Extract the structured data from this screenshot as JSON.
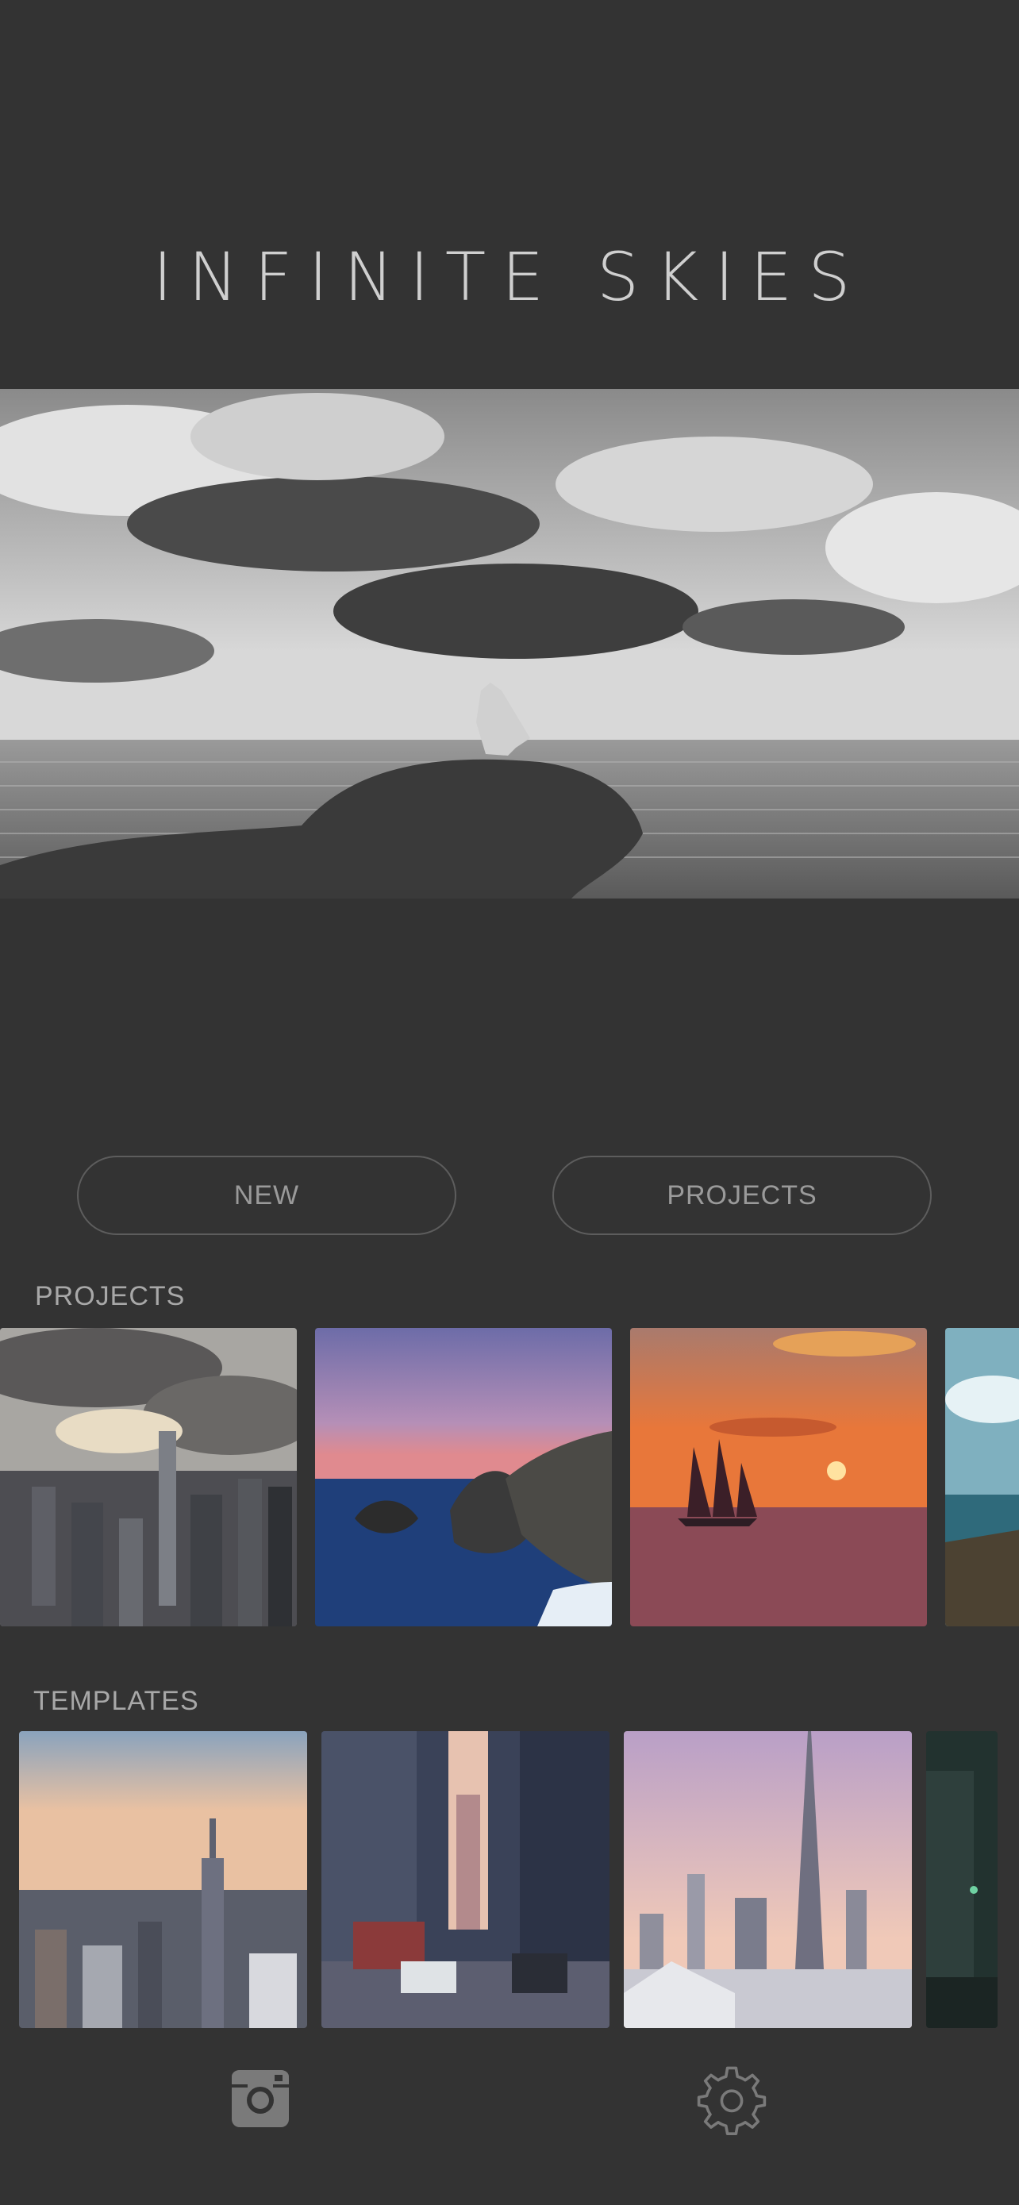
{
  "app": {
    "title": "INFINITE SKIES"
  },
  "hero": {
    "icon": "hero-image"
  },
  "actions": {
    "new_label": "NEW",
    "projects_label": "PROJECTS"
  },
  "sections": {
    "projects_label": "PROJECTS",
    "templates_label": "TEMPLATES"
  },
  "projects": [
    {
      "name": "project-city-clouds"
    },
    {
      "name": "project-coast-rocks"
    },
    {
      "name": "project-sunset-sailboat"
    },
    {
      "name": "project-beach-partial"
    }
  ],
  "templates": [
    {
      "name": "template-empire-state"
    },
    {
      "name": "template-city-street"
    },
    {
      "name": "template-dubai-skyline"
    },
    {
      "name": "template-night-street-partial"
    }
  ],
  "tabbar": {
    "left_icon": "instagram-icon",
    "right_icon": "gear-icon"
  },
  "colors": {
    "background": "#333333",
    "button_border": "#5d5d5d",
    "text": "#a8a8a8"
  }
}
